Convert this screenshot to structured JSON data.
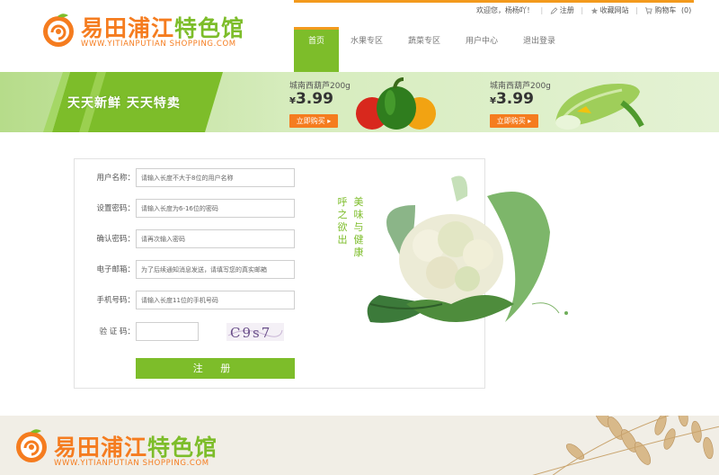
{
  "brand": {
    "title_orange": "易田浦江",
    "title_green": "特色馆",
    "subtitle": "WWW.YITIANPUTIAN SHOPPING.COM",
    "footer_subtitle": "WWW.YITIANPUTIAN SHOPPING.COM"
  },
  "toplinks": {
    "welcome": "欢迎您，杨杨吖！",
    "register": "注册",
    "favorite": "收藏网站",
    "cart": "购物车",
    "cart_count": "(0)"
  },
  "nav": {
    "items": [
      {
        "label": "首页",
        "active": true
      },
      {
        "label": "水果专区",
        "active": false
      },
      {
        "label": "蔬菜专区",
        "active": false
      },
      {
        "label": "用户中心",
        "active": false
      },
      {
        "label": "退出登录",
        "active": false
      }
    ]
  },
  "banner": {
    "slogan": "天天新鲜  天天特卖",
    "promos": [
      {
        "name": "城南西葫芦200g",
        "currency": "¥",
        "price": "3.99",
        "button": "立即购买"
      },
      {
        "name": "城南西葫芦200g",
        "currency": "¥",
        "price": "3.99",
        "button": "立即购买"
      }
    ]
  },
  "form": {
    "fields": [
      {
        "label": "用户名称：",
        "placeholder": "请输入长度不大于8位的用户名称"
      },
      {
        "label": "设置密码：",
        "placeholder": "请输入长度为6-16位的密码"
      },
      {
        "label": "确认密码：",
        "placeholder": "请再次输入密码"
      },
      {
        "label": "电子邮箱：",
        "placeholder": "为了后续通知消息发送，请填写您的真实邮箱"
      },
      {
        "label": "手机号码：",
        "placeholder": "请输入长度11位的手机号码"
      }
    ],
    "captcha_label": "验 证 码：",
    "captcha_value": "",
    "captcha_text": "C9s7",
    "submit": "注 册"
  },
  "poem": {
    "col1": "呼之欲出",
    "col2": "美味与健康"
  },
  "colors": {
    "brand_green": "#7dbd2a",
    "brand_orange": "#f57c1f",
    "accent_yellow": "#f39a1d"
  }
}
